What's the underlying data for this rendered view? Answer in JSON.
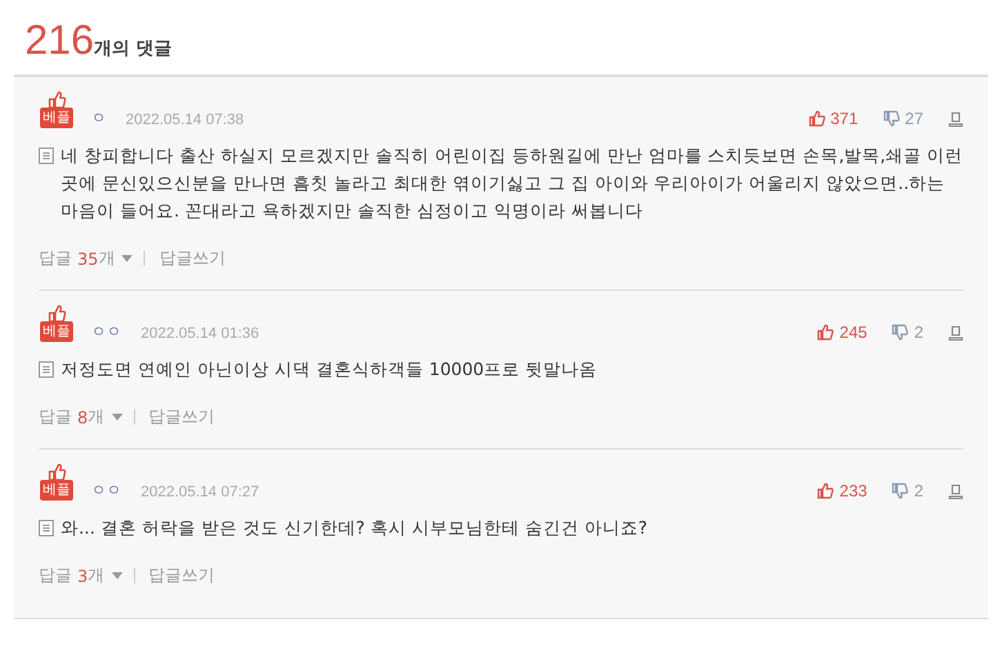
{
  "header": {
    "count": "216",
    "label": "개의 댓글"
  },
  "comments": [
    {
      "badge": "베플",
      "nickname": "ㅇ",
      "date": "2022.05.14 07:38",
      "likes": "371",
      "dislikes": "27",
      "text": "네 창피합니다 출산 하실지 모르겠지만 솔직히 어린이집 등하원길에 만난 엄마를 스치듯보면 손목,발목,쇄골 이런곳에 문신있으신분을 만나면 흠칫 놀라고 최대한 엮이기싫고 그 집 아이와 우리아이가 어울리지 않았으면..하는 마음이 들어요. 꼰대라고 욕하겠지만 솔직한 심정이고 익명이라 써봅니다",
      "reply_label": "답글",
      "reply_count": "35",
      "reply_unit": "개",
      "write_reply": "답글쓰기"
    },
    {
      "badge": "베플",
      "nickname": "ㅇㅇ",
      "date": "2022.05.14 01:36",
      "likes": "245",
      "dislikes": "2",
      "text": "저정도면 연예인 아닌이상 시댁 결혼식하객들 10000프로 뒷말나옴",
      "reply_label": "답글",
      "reply_count": "8",
      "reply_unit": "개",
      "write_reply": "답글쓰기"
    },
    {
      "badge": "베플",
      "nickname": "ㅇㅇ",
      "date": "2022.05.14 07:27",
      "likes": "233",
      "dislikes": "2",
      "text": "와... 결혼 허락을 받은 것도 신기한데? 혹시 시부모님한테 숨긴건 아니죠?",
      "reply_label": "답글",
      "reply_count": "3",
      "reply_unit": "개",
      "write_reply": "답글쓰기"
    }
  ]
}
